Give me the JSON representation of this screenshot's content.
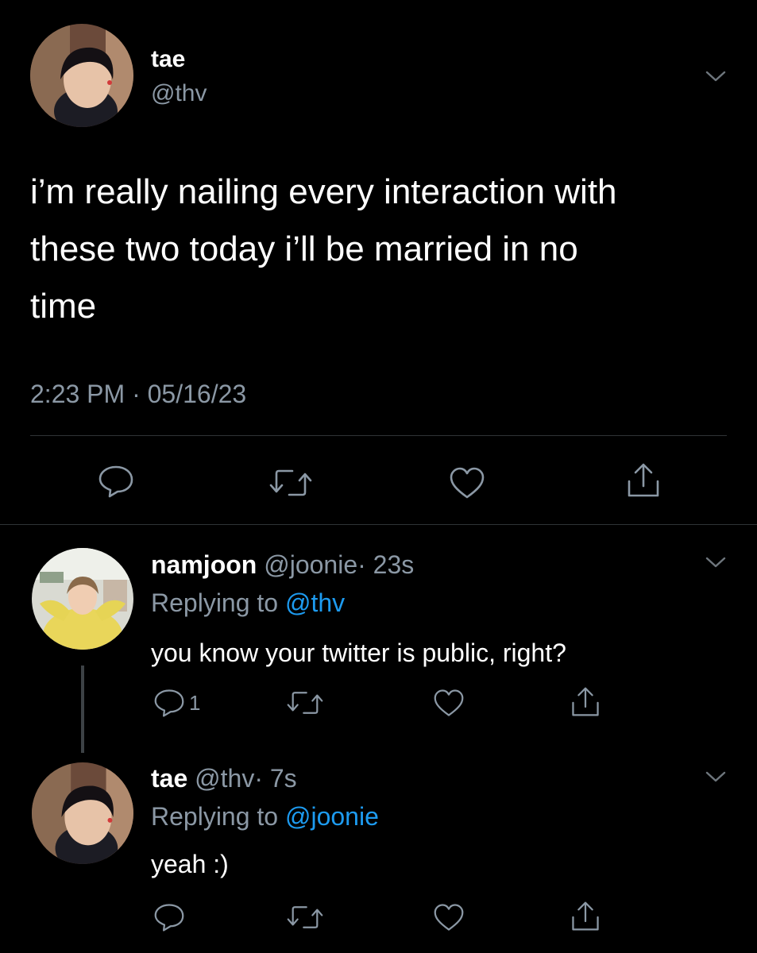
{
  "main_tweet": {
    "display_name": "tae",
    "handle": "@thv",
    "text_line1": "i’m really nailing every interaction with",
    "text_line2": "these two today i’ll be married in no",
    "text_line3": "time",
    "timestamp": "2:23 PM · 05/16/23"
  },
  "reply1": {
    "display_name": "namjoon",
    "handle": "@joonie",
    "time": "· 23s",
    "replying_prefix": "Replying to",
    "replying_to": "@thv",
    "text": "you know your twitter is public, right?",
    "reply_count": "1"
  },
  "reply2": {
    "display_name": "tae",
    "handle": "@thv",
    "time": "· 7s",
    "replying_prefix": "Replying to",
    "replying_to": "@joonie",
    "text": "yeah :)"
  },
  "icons": {
    "reply": "reply-icon",
    "retweet": "retweet-icon",
    "like": "heart-icon",
    "share": "share-icon",
    "menu": "chevron-down-icon"
  },
  "colors": {
    "background": "#000000",
    "link": "#1d9bf0",
    "muted": "#8b98a5",
    "divider": "#2f3336"
  }
}
